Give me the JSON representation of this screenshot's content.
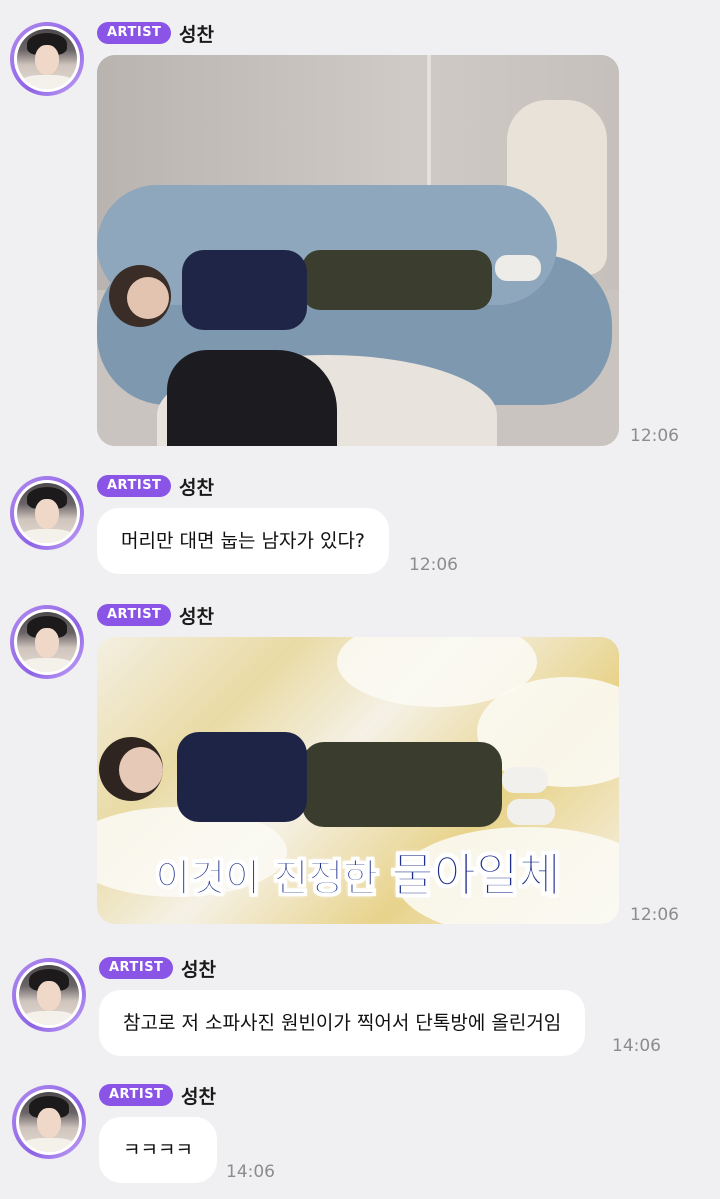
{
  "messages": [
    {
      "id": "m1",
      "badge": "ARTIST",
      "name": "성찬",
      "time": "12:06",
      "type": "photo",
      "photo_desc": "sofa-photo"
    },
    {
      "id": "m2",
      "badge": "ARTIST",
      "name": "성찬",
      "time": "12:06",
      "type": "text",
      "text": "머리만 대면 눕는 남자가 있다?"
    },
    {
      "id": "m3",
      "badge": "ARTIST",
      "name": "성찬",
      "time": "12:06",
      "type": "photo",
      "caption_small": "이것이 진정한 ",
      "caption_big": "물아일체"
    },
    {
      "id": "m4",
      "badge": "ARTIST",
      "name": "성찬",
      "time": "14:06",
      "type": "text",
      "text": "참고로 저 소파사진 원빈이가 찍어서 단톡방에 올린거임"
    },
    {
      "id": "m5",
      "badge": "ARTIST",
      "name": "성찬",
      "time": "14:06",
      "type": "text",
      "text": "ㅋㅋㅋㅋ"
    }
  ],
  "colors": {
    "background": "#f0f0f2",
    "badge": "#8a54e6",
    "bubble": "#ffffff",
    "time": "#8c8c8c"
  },
  "icons": [
    "avatar-image"
  ]
}
